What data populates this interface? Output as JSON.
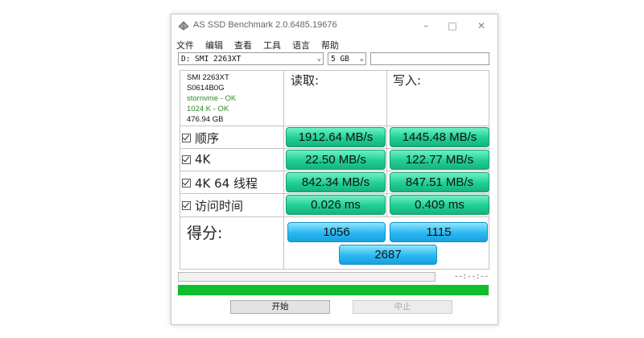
{
  "window": {
    "title": "AS SSD Benchmark 2.0.6485.19676"
  },
  "menu": [
    "文件",
    "编辑",
    "查看",
    "工具",
    "语言",
    "帮助"
  ],
  "drive_select": {
    "value": "D: SMI 2263XT"
  },
  "size_select": {
    "value": "5 GB"
  },
  "drive_info": {
    "model": "SMI 2263XT",
    "serial": "S0614B0G",
    "driver": "stornvme - OK",
    "alignment": "1024 K - OK",
    "capacity": "476.94 GB"
  },
  "columns": {
    "read": "读取:",
    "write": "写入:"
  },
  "tests": [
    {
      "label": "顺序",
      "read": "1912.64 MB/s",
      "write": "1445.48 MB/s"
    },
    {
      "label": "4K",
      "read": "22.50 MB/s",
      "write": "122.77 MB/s"
    },
    {
      "label": "4K 64 线程",
      "read": "842.34 MB/s",
      "write": "847.51 MB/s"
    },
    {
      "label": "访问时间",
      "read": "0.026 ms",
      "write": "0.409 ms"
    }
  ],
  "score": {
    "label": "得分:",
    "read": "1056",
    "write": "1115",
    "total": "2687"
  },
  "progress": {
    "time": "--:--:--",
    "fraction": 1.0
  },
  "buttons": {
    "start": "开始",
    "stop": "中止"
  },
  "colors": {
    "result_green": "#1fcf93",
    "score_blue": "#29b8f0",
    "progress_green": "#0fbe2b"
  }
}
